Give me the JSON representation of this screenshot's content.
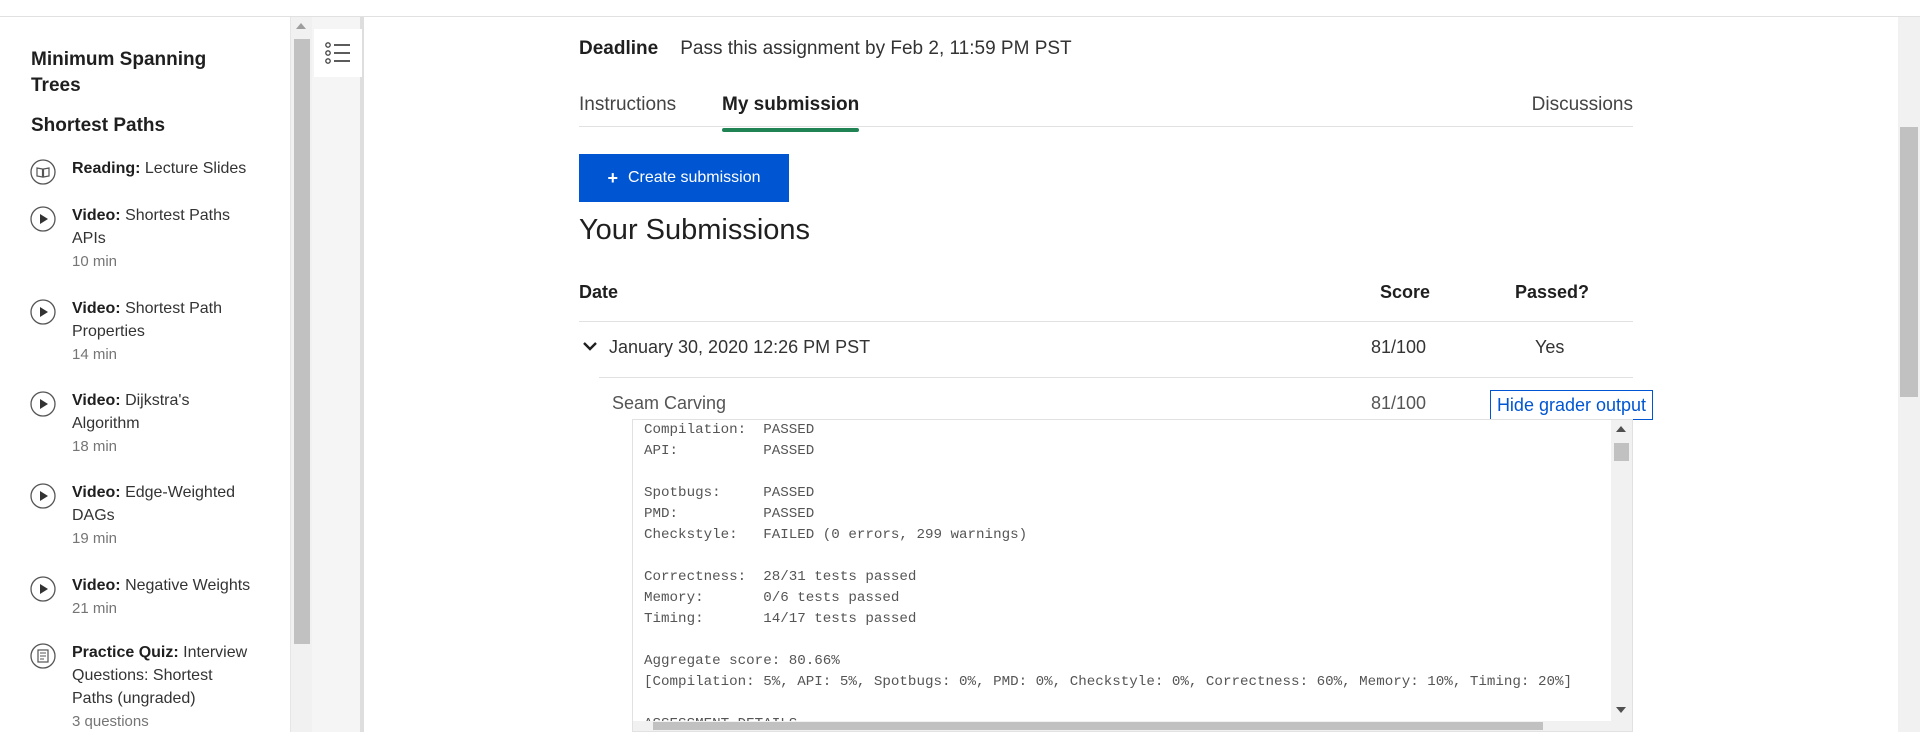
{
  "sidebar": {
    "sections": [
      {
        "title": "Minimum Spanning Trees"
      },
      {
        "title": "Shortest Paths"
      }
    ],
    "items": [
      {
        "type": "Reading:",
        "title": "Lecture Slides",
        "meta": "",
        "icon": "book-icon"
      },
      {
        "type": "Video:",
        "title": "Shortest Paths APIs",
        "meta": "10 min",
        "icon": "play-icon"
      },
      {
        "type": "Video:",
        "title": "Shortest Path Properties",
        "meta": "14 min",
        "icon": "play-icon"
      },
      {
        "type": "Video:",
        "title": "Dijkstra's Algorithm",
        "meta": "18 min",
        "icon": "play-icon"
      },
      {
        "type": "Video:",
        "title": "Edge-Weighted DAGs",
        "meta": "19 min",
        "icon": "play-icon"
      },
      {
        "type": "Video:",
        "title": "Negative Weights",
        "meta": "21 min",
        "icon": "play-icon"
      },
      {
        "type": "Practice Quiz:",
        "title": "Interview Questions: Shortest Paths (ungraded)",
        "meta": "3 questions",
        "icon": "quiz-icon"
      }
    ]
  },
  "deadline": {
    "label": "Deadline",
    "value": "Pass this assignment by Feb 2, 11:59 PM PST"
  },
  "tabs": [
    {
      "label": "Instructions",
      "active": false
    },
    {
      "label": "My submission",
      "active": true
    },
    {
      "label": "Discussions",
      "active": false
    }
  ],
  "create_button": {
    "label": "Create submission"
  },
  "submissions": {
    "title": "Your Submissions",
    "columns": {
      "date": "Date",
      "score": "Score",
      "passed": "Passed?"
    },
    "rows": [
      {
        "date": "January 30, 2020 12:26 PM PST",
        "score": "81/100",
        "passed": "Yes"
      }
    ],
    "part": {
      "name": "Seam Carving",
      "score": "81/100",
      "toggle_label": "Hide grader output"
    }
  },
  "grader_output": [
    "Compilation:  PASSED",
    "API:          PASSED",
    "",
    "Spotbugs:     PASSED",
    "PMD:          PASSED",
    "Checkstyle:   FAILED (0 errors, 299 warnings)",
    "",
    "Correctness:  28/31 tests passed",
    "Memory:       0/6 tests passed",
    "Timing:       14/17 tests passed",
    "",
    "Aggregate score: 80.66%",
    "[Compilation: 5%, API: 5%, Spotbugs: 0%, PMD: 0%, Checkstyle: 0%, Correctness: 60%, Memory: 10%, Timing: 20%]",
    "",
    "ASSESSMENT DETAILS"
  ],
  "colors": {
    "accent": "#0056d2",
    "tab_underline": "#1f8354"
  }
}
